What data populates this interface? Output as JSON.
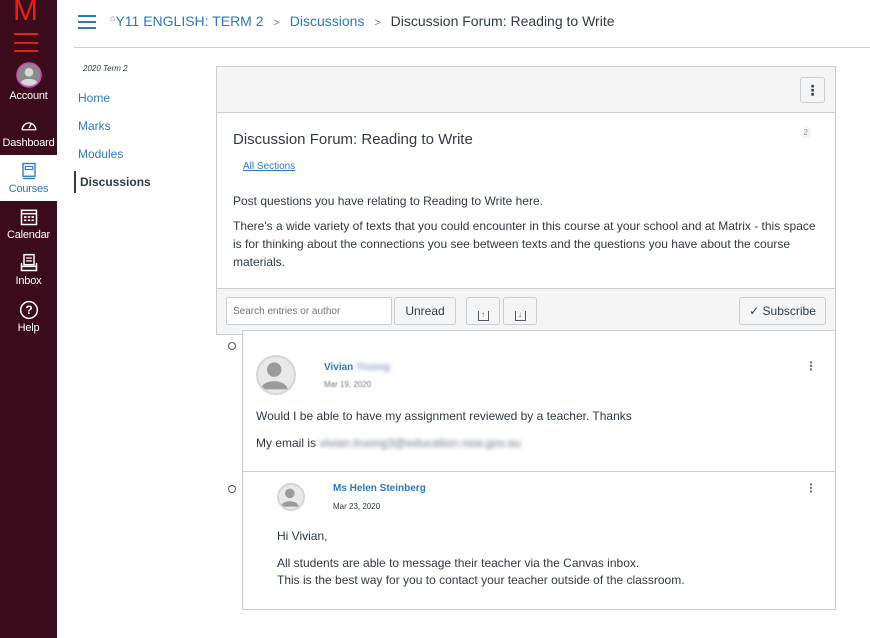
{
  "global_nav": {
    "logo": "M",
    "items": [
      {
        "label": "Account",
        "icon": "account-avatar-icon"
      },
      {
        "label": "Dashboard",
        "icon": "dashboard-gauge-icon"
      },
      {
        "label": "Courses",
        "icon": "courses-book-icon",
        "active": true
      },
      {
        "label": "Calendar",
        "icon": "calendar-icon"
      },
      {
        "label": "Inbox",
        "icon": "inbox-icon"
      },
      {
        "label": "Help",
        "icon": "help-question-icon"
      }
    ],
    "colors": {
      "background": "#3b0a1b",
      "logo": "#e0241b",
      "active_text": "#2b7abc"
    }
  },
  "breadcrumb": {
    "course": "Y11 ENGLISH: TERM 2",
    "section": "Discussions",
    "current": "Discussion Forum: Reading to Write"
  },
  "course_nav": {
    "term": "2020 Term 2",
    "items": [
      {
        "label": "Home"
      },
      {
        "label": "Marks"
      },
      {
        "label": "Modules"
      },
      {
        "label": "Discussions",
        "active": true
      }
    ]
  },
  "discussion": {
    "title": "Discussion Forum: Reading to Write",
    "sections": "All Sections",
    "reply_count": "2",
    "body": [
      "Post questions you have relating to Reading to Write here.",
      "There's a wide variety of texts that you could encounter in this course at your school and at Matrix - this space is for thinking about the connections you see between texts and the questions you have about the course materials."
    ],
    "toolbar": {
      "search_placeholder": "Search entries or author",
      "unread_label": "Unread",
      "subscribe_label": "Subscribe",
      "expand_icon": "collapse-up-icon",
      "collapse_icon": "expand-down-icon"
    }
  },
  "entries": [
    {
      "author_first": "Vivian",
      "author_last_redacted": "Truong",
      "date": "Mar 19, 2020",
      "lines": [
        "Would I be able to have my assignment reviewed by a teacher. Thanks"
      ],
      "email_prefix": "My email is ",
      "email_redacted": "vivian.truong3@education.nsw.gov.au"
    },
    {
      "author": "Ms Helen Steinberg",
      "date": "Mar 23, 2020",
      "greeting": "Hi Vivian,",
      "lines": [
        "All students are able to message their teacher via the Canvas inbox.",
        "This is the best way for you to contact your teacher outside of the classroom."
      ]
    }
  ]
}
